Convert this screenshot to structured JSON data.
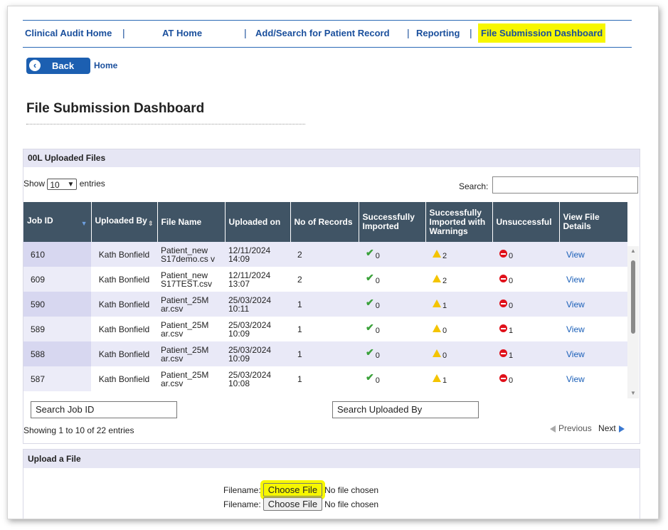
{
  "nav": {
    "items": [
      {
        "label": "Clinical Audit Home"
      },
      {
        "label": "AT Home"
      },
      {
        "label": "Add/Search for Patient Record"
      },
      {
        "label": "Reporting"
      },
      {
        "label": "File Submission Dashboard"
      }
    ],
    "highlight_color": "#f7f700"
  },
  "back_label": "Back",
  "home_link": "Home",
  "page_title": "File Submission Dashboard",
  "files_panel": {
    "title": "00L Uploaded Files",
    "show_prefix": "Show",
    "entries_value": "10",
    "show_suffix": "entries",
    "search_label": "Search:",
    "columns": [
      "Job ID",
      "Uploaded By",
      "File Name",
      "Uploaded on",
      "No of Records",
      "Successfully Imported",
      "Successfully Imported with Warnings",
      "Unsuccessful",
      "View File Details"
    ],
    "rows": [
      {
        "job": "610",
        "by": "Kath Bonfield",
        "file": "Patient_new S17demo.cs v",
        "on": "12/11/2024 14:09",
        "records": "2",
        "ok": "0",
        "warn": "2",
        "fail": "0",
        "view": "View"
      },
      {
        "job": "609",
        "by": "Kath Bonfield",
        "file": "Patient_new S17TEST.csv",
        "on": "12/11/2024 13:07",
        "records": "2",
        "ok": "0",
        "warn": "2",
        "fail": "0",
        "view": "View"
      },
      {
        "job": "590",
        "by": "Kath Bonfield",
        "file": "Patient_25M ar.csv",
        "on": "25/03/2024 10:11",
        "records": "1",
        "ok": "0",
        "warn": "1",
        "fail": "0",
        "view": "View"
      },
      {
        "job": "589",
        "by": "Kath Bonfield",
        "file": "Patient_25M ar.csv",
        "on": "25/03/2024 10:09",
        "records": "1",
        "ok": "0",
        "warn": "0",
        "fail": "1",
        "view": "View"
      },
      {
        "job": "588",
        "by": "Kath Bonfield",
        "file": "Patient_25M ar.csv",
        "on": "25/03/2024 10:09",
        "records": "1",
        "ok": "0",
        "warn": "0",
        "fail": "1",
        "view": "View"
      },
      {
        "job": "587",
        "by": "Kath Bonfield",
        "file": "Patient_25M ar.csv",
        "on": "25/03/2024 10:08",
        "records": "1",
        "ok": "0",
        "warn": "1",
        "fail": "0",
        "view": "View"
      }
    ],
    "filter_job_placeholder": "Search Job ID",
    "filter_by_placeholder": "Search Uploaded By",
    "showing": "Showing 1 to 10 of 22 entries",
    "previous": "Previous",
    "next": "Next"
  },
  "upload_panel": {
    "title": "Upload a File",
    "filename_label": "Filename:",
    "choose_file": "Choose File",
    "no_file": "No file chosen"
  }
}
